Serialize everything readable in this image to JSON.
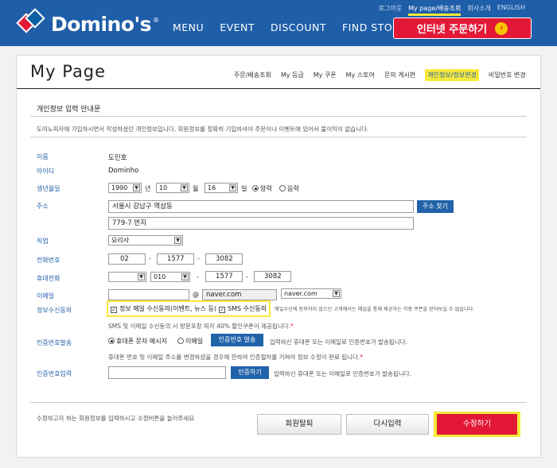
{
  "header": {
    "brand": "Domino's",
    "top_links": [
      "로그아웃",
      "My page/배송조회",
      "회사소개",
      "ENGLISH"
    ],
    "gnb": [
      "MENU",
      "EVENT",
      "DISCOUNT",
      "FIND STORE"
    ],
    "order_button": "인터넷 주문하기",
    "colors": {
      "brand_blue": "#1f5ea8",
      "brand_red": "#e31837",
      "highlight_yellow": "#f7e93a"
    }
  },
  "page": {
    "title": "My Page",
    "subnav": [
      "주문/배송조회",
      "My 등급",
      "My 쿠폰",
      "My 스토어",
      "문의 게시판",
      "개인정보/정보변경",
      "비밀번호 변경"
    ],
    "active_subnav": "개인정보/정보변경"
  },
  "form": {
    "title": "개인정보 입력 안내문",
    "description": "도미노피자에 가입하시면서 작성하셨던 개인정보입니다. 회원정보를 정확히 기입하셔야 주문이나 이벤트에 있어서 불이익이 없습니다.",
    "name_label": "이름",
    "name_value": "도민호",
    "id_label": "아이디",
    "id_value": "Dominho",
    "birth_label": "생년월일",
    "birth_year": "1990",
    "birth_year_unit": "년",
    "birth_month": "10",
    "birth_month_unit": "월",
    "birth_day": "16",
    "birth_day_unit": "일",
    "calendar_solar": "양력",
    "calendar_lunar": "음력",
    "address_label": "주소",
    "address_1": "서울시 강남구 역삼동",
    "address_2": "779-7 번지",
    "address_button": "주소 찾기",
    "job_label": "직업",
    "job_value": "요리사",
    "phone_label": "전화번호",
    "phone": [
      "02",
      "1577",
      "3082"
    ],
    "dash": "-",
    "mobile_label": "휴대전화",
    "mobile_carrier": "",
    "mobile_prefix": "010",
    "mobile": [
      "1577",
      "3082"
    ],
    "email_label": "이메일",
    "email_id": "",
    "email_at": "@",
    "email_domain": "naver.com",
    "email_domain_select": "naver.com",
    "consent_label": "정보수신동의",
    "consent_email": "정보 메일 수신동의(이벤트, 뉴스 등)",
    "consent_sms": "SMS 수신동의",
    "consent_note": "메일수신에 동의하지 않으신 고객께서는 메일을 통해 제공하는 각종 쿠폰을 받아보실 수 없습니다.",
    "consent_note2": "SMS 및 이메일 수신동의 시 방문포장 피자 40% 할인쿠폰이 제공됩니다.",
    "star": "*",
    "auth_send_label": "인증번호발송",
    "auth_phone": "휴대폰 문자 메시지",
    "auth_email": "이메일",
    "auth_send_button": "인증번호 발송",
    "auth_send_hint": "입력하신 휴대폰 또는 이메일로 인증번호가 발송됩니다.",
    "auth_change_note": "휴대폰 번호 및 이메일 주소를 변경하셨을 경우에 한하여 인증절차를 거쳐야 정보 수정이 완료 됩니다.",
    "auth_input_label": "인증번호입력",
    "auth_input_value": "",
    "auth_confirm_button": "인증하기",
    "auth_input_hint": "입력하신 휴대폰 또는 이메일로 인증번호가 발송됩니다."
  },
  "footer": {
    "hint": "수정하고자 하는 회원정보를 입력하시고 수정버튼을 눌러주세요",
    "withdraw_button": "회원탈퇴",
    "reset_button": "다시입력",
    "submit_button": "수정하기"
  },
  "icons": {
    "dropdown": "chevron-down-icon",
    "order_arrow": "arrow-right-icon"
  }
}
